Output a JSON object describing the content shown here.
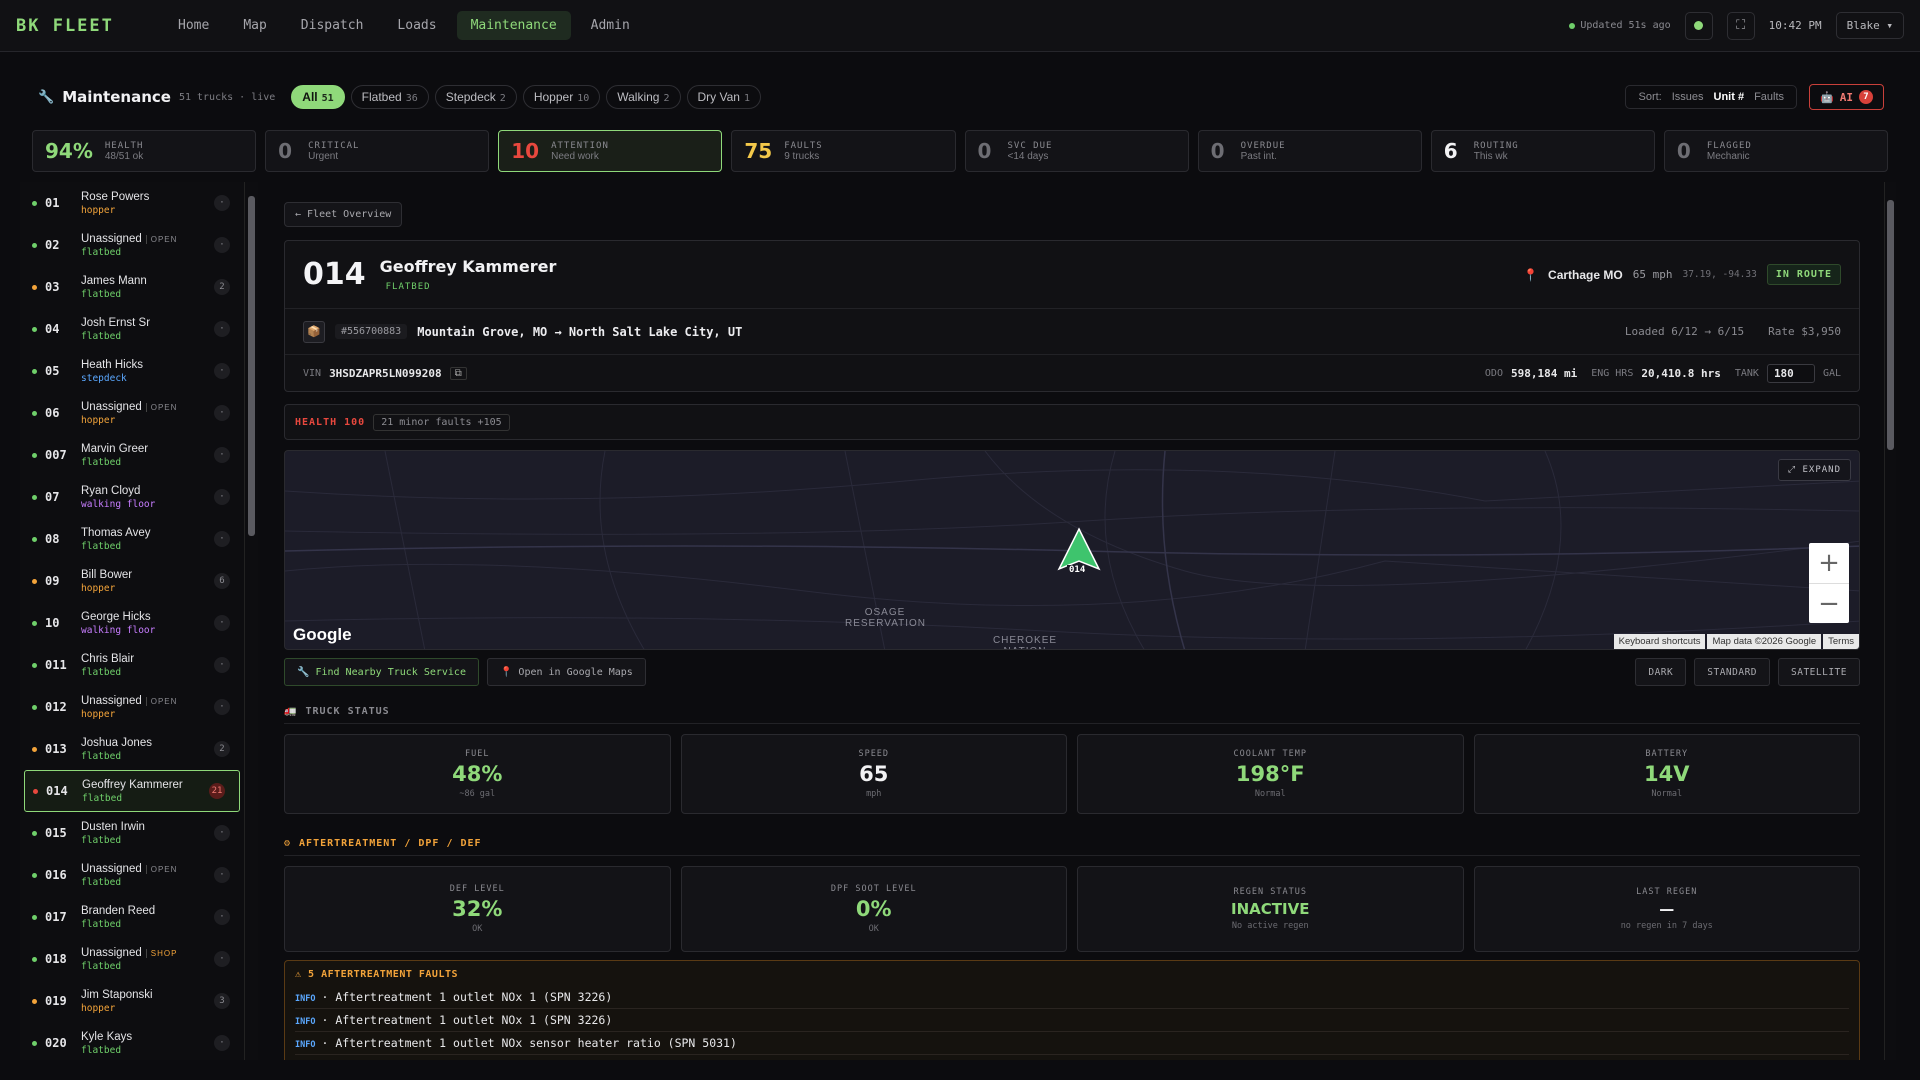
{
  "brand": "BK FLEET",
  "nav": [
    {
      "label": "Home",
      "active": false
    },
    {
      "label": "Map",
      "active": false
    },
    {
      "label": "Dispatch",
      "active": false
    },
    {
      "label": "Loads",
      "active": false
    },
    {
      "label": "Maintenance",
      "active": true
    },
    {
      "label": "Admin",
      "active": false
    }
  ],
  "topbar": {
    "updated": "Updated 51s ago",
    "time": "10:42 PM",
    "user": "Blake"
  },
  "header": {
    "title": "Maintenance",
    "subtitle": "51 trucks · live",
    "filters": [
      {
        "label": "All",
        "count": "51",
        "active": true
      },
      {
        "label": "Flatbed",
        "count": "36",
        "active": false
      },
      {
        "label": "Stepdeck",
        "count": "2",
        "active": false
      },
      {
        "label": "Hopper",
        "count": "10",
        "active": false
      },
      {
        "label": "Walking",
        "count": "2",
        "active": false
      },
      {
        "label": "Dry Van",
        "count": "1",
        "active": false
      }
    ],
    "sort_label": "Sort:",
    "sort_options": [
      "Issues",
      "Unit #",
      "Faults"
    ],
    "sort_active": "Unit #",
    "ai_label": "AI",
    "ai_badge": "7"
  },
  "stats": [
    {
      "value": "94%",
      "label": "HEALTH",
      "sub": "48/51 ok",
      "kind": "health"
    },
    {
      "value": "0",
      "label": "CRITICAL",
      "sub": "Urgent",
      "kind": ""
    },
    {
      "value": "10",
      "label": "ATTENTION",
      "sub": "Need work",
      "kind": "attn"
    },
    {
      "value": "75",
      "label": "FAULTS",
      "sub": "9 trucks",
      "kind": "faults"
    },
    {
      "value": "0",
      "label": "SVC DUE",
      "sub": "<14 days",
      "kind": ""
    },
    {
      "value": "0",
      "label": "OVERDUE",
      "sub": "Past int.",
      "kind": ""
    },
    {
      "value": "6",
      "label": "ROUTING",
      "sub": "This wk",
      "kind": "routing"
    },
    {
      "value": "0",
      "label": "FLAGGED",
      "sub": "Mechanic",
      "kind": ""
    }
  ],
  "trucks": [
    {
      "unit": "01",
      "name": "Rose Powers",
      "tag": "",
      "type": "hopper",
      "count": "·",
      "dot": "green"
    },
    {
      "unit": "02",
      "name": "Unassigned",
      "tag": "OPEN",
      "type": "flatbed",
      "count": "·",
      "dot": "green"
    },
    {
      "unit": "03",
      "name": "James Mann",
      "tag": "",
      "type": "flatbed",
      "count": "2",
      "dot": "orange"
    },
    {
      "unit": "04",
      "name": "Josh Ernst Sr",
      "tag": "",
      "type": "flatbed",
      "count": "·",
      "dot": "green"
    },
    {
      "unit": "05",
      "name": "Heath Hicks",
      "tag": "",
      "type": "stepdeck",
      "count": "·",
      "dot": "green"
    },
    {
      "unit": "06",
      "name": "Unassigned",
      "tag": "OPEN",
      "type": "hopper",
      "count": "·",
      "dot": "green"
    },
    {
      "unit": "007",
      "name": "Marvin Greer",
      "tag": "",
      "type": "flatbed",
      "count": "·",
      "dot": "green"
    },
    {
      "unit": "07",
      "name": "Ryan Cloyd",
      "tag": "",
      "type": "walking floor",
      "count": "·",
      "dot": "green"
    },
    {
      "unit": "08",
      "name": "Thomas Avey",
      "tag": "",
      "type": "flatbed",
      "count": "·",
      "dot": "green"
    },
    {
      "unit": "09",
      "name": "Bill Bower",
      "tag": "",
      "type": "hopper",
      "count": "6",
      "dot": "orange"
    },
    {
      "unit": "10",
      "name": "George Hicks",
      "tag": "",
      "type": "walking floor",
      "count": "·",
      "dot": "green"
    },
    {
      "unit": "011",
      "name": "Chris Blair",
      "tag": "",
      "type": "flatbed",
      "count": "·",
      "dot": "green"
    },
    {
      "unit": "012",
      "name": "Unassigned",
      "tag": "OPEN",
      "type": "hopper",
      "count": "·",
      "dot": "green"
    },
    {
      "unit": "013",
      "name": "Joshua Jones",
      "tag": "",
      "type": "flatbed",
      "count": "2",
      "dot": "orange"
    },
    {
      "unit": "014",
      "name": "Geoffrey Kammerer",
      "tag": "",
      "type": "flatbed",
      "count": "21",
      "dot": "red",
      "selected": true
    },
    {
      "unit": "015",
      "name": "Dusten Irwin",
      "tag": "",
      "type": "flatbed",
      "count": "·",
      "dot": "green"
    },
    {
      "unit": "016",
      "name": "Unassigned",
      "tag": "OPEN",
      "type": "flatbed",
      "count": "·",
      "dot": "green"
    },
    {
      "unit": "017",
      "name": "Branden Reed",
      "tag": "",
      "type": "flatbed",
      "count": "·",
      "dot": "green"
    },
    {
      "unit": "018",
      "name": "Unassigned",
      "tag": "SHOP",
      "type": "flatbed",
      "count": "·",
      "dot": "green"
    },
    {
      "unit": "019",
      "name": "Jim Staponski",
      "tag": "",
      "type": "hopper",
      "count": "3",
      "dot": "orange"
    },
    {
      "unit": "020",
      "name": "Kyle Kays",
      "tag": "",
      "type": "flatbed",
      "count": "·",
      "dot": "green"
    }
  ],
  "detail": {
    "back": "← Fleet Overview",
    "unit": "014",
    "driver": "Geoffrey Kammerer",
    "type": "FLATBED",
    "city": "Carthage MO",
    "speed": "65 mph",
    "coords": "37.19, -94.33",
    "status": "IN ROUTE",
    "load_id": "#556700883",
    "route": "Mountain Grove, MO → North Salt Lake City, UT",
    "loaded": "Loaded 6/12 → 6/15",
    "rate": "Rate $3,950",
    "vin_label": "VIN",
    "vin": "3HSDZAPR5LN099208",
    "odo_label": "ODO",
    "odo": "598,184 mi",
    "eng_label": "ENG HRS",
    "eng": "20,410.8 hrs",
    "tank_label": "TANK",
    "tank": "180",
    "gal": "GAL",
    "health": "HEALTH 100",
    "health_note": "21 minor faults +105"
  },
  "map": {
    "expand": "⤢ EXPAND",
    "labels": [
      "OSAGE RESERVATION",
      "CHEROKEE NATION"
    ],
    "marker": "014",
    "google": "Google",
    "footer": [
      "Keyboard shortcuts",
      "Map data ©2026 Google",
      "Terms"
    ]
  },
  "map_buttons": {
    "nearby": "Find Nearby Truck Service",
    "gmaps": "Open in Google Maps",
    "styles": [
      "DARK",
      "STANDARD",
      "SATELLITE"
    ]
  },
  "truck_status": {
    "title": "TRUCK STATUS",
    "gauges": [
      {
        "label": "FUEL",
        "value": "48%",
        "sub": "~86 gal"
      },
      {
        "label": "SPEED",
        "value": "65",
        "sub": "mph"
      },
      {
        "label": "COOLANT TEMP",
        "value": "198°F",
        "sub": "Normal"
      },
      {
        "label": "BATTERY",
        "value": "14V",
        "sub": "Normal"
      }
    ]
  },
  "aftertreatment": {
    "title": "AFTERTREATMENT / DPF / DEF",
    "gauges": [
      {
        "label": "DEF LEVEL",
        "value": "32%",
        "sub": "OK"
      },
      {
        "label": "DPF SOOT LEVEL",
        "value": "0%",
        "sub": "OK"
      },
      {
        "label": "REGEN STATUS",
        "value": "INACTIVE",
        "sub": "No active regen"
      },
      {
        "label": "LAST REGEN",
        "value": "—",
        "sub": "no regen in 7 days"
      }
    ],
    "faults_title": "⚠ 5 AFTERTREATMENT FAULTS",
    "faults": [
      {
        "level": "INFO",
        "text": "· Aftertreatment 1 outlet NOx 1 (SPN 3226)"
      },
      {
        "level": "INFO",
        "text": "· Aftertreatment 1 outlet NOx 1 (SPN 3226)"
      },
      {
        "level": "INFO",
        "text": "· Aftertreatment 1 outlet NOx sensor heater ratio (SPN 5031)"
      }
    ]
  },
  "colors": {
    "accent": "#8fd97a",
    "danger": "#e8483e",
    "warning": "#f2a33a",
    "info": "#5ba8ff"
  }
}
